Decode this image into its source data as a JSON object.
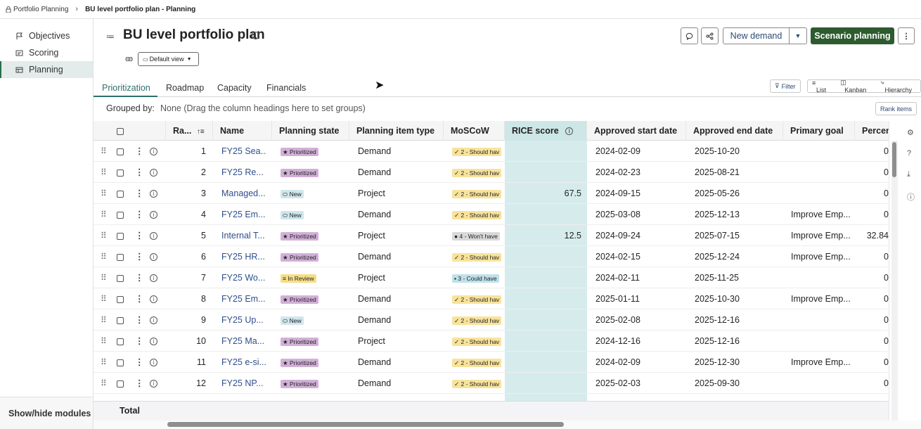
{
  "breadcrumb": {
    "root": "Portfolio Planning",
    "current": "BU level portfolio plan - Planning"
  },
  "sidebar": {
    "items": [
      {
        "label": "Objectives",
        "icon": "flag-icon",
        "active": false
      },
      {
        "label": "Scoring",
        "icon": "scoring-icon",
        "active": false
      },
      {
        "label": "Planning",
        "icon": "planning-icon",
        "active": true
      }
    ],
    "footer": "Show/hide modules"
  },
  "header": {
    "title": "BU level portfolio plan",
    "new_demand": "New demand",
    "scenario_planning": "Scenario planning"
  },
  "view": {
    "selected": "Default view"
  },
  "tabs": [
    "Prioritization",
    "Roadmap",
    "Capacity",
    "Financials"
  ],
  "toolbar": {
    "filter": "Filter",
    "list": "List",
    "kanban": "Kanban",
    "hierarchy": "Hierarchy",
    "rank_items": "Rank items"
  },
  "grouping": {
    "label": "Grouped by:",
    "hint": "None (Drag the column headings here to set groups)"
  },
  "columns": [
    "Ra...",
    "Name",
    "Planning state",
    "Planning item type",
    "MoSCoW",
    "RICE score",
    "Approved start date",
    "Approved end date",
    "Primary goal",
    "Percen"
  ],
  "rows": [
    {
      "rank": "1",
      "name": "FY25 Sea...",
      "state": "Prioritized",
      "type": "Demand",
      "moscow": "2 - Should hav",
      "rice": "",
      "start": "2024-02-09",
      "end": "2025-10-20",
      "goal": "",
      "pct": "0"
    },
    {
      "rank": "2",
      "name": "FY25 Re...",
      "state": "Prioritized",
      "type": "Demand",
      "moscow": "2 - Should hav",
      "rice": "",
      "start": "2024-02-23",
      "end": "2025-08-21",
      "goal": "",
      "pct": "0"
    },
    {
      "rank": "3",
      "name": "Managed...",
      "state": "New",
      "type": "Project",
      "moscow": "2 - Should hav",
      "rice": "67.5",
      "start": "2024-09-15",
      "end": "2025-05-26",
      "goal": "",
      "pct": "0"
    },
    {
      "rank": "4",
      "name": "FY25 Em...",
      "state": "New",
      "type": "Demand",
      "moscow": "2 - Should hav",
      "rice": "",
      "start": "2025-03-08",
      "end": "2025-12-13",
      "goal": "Improve Emp...",
      "pct": "0"
    },
    {
      "rank": "5",
      "name": "Internal T...",
      "state": "Prioritized",
      "type": "Project",
      "moscow": "4 - Won't have",
      "rice": "12.5",
      "start": "2024-09-24",
      "end": "2025-07-15",
      "goal": "Improve Emp...",
      "pct": "32.84"
    },
    {
      "rank": "6",
      "name": "FY25 HR...",
      "state": "Prioritized",
      "type": "Demand",
      "moscow": "2 - Should hav",
      "rice": "",
      "start": "2024-02-15",
      "end": "2025-12-24",
      "goal": "Improve Emp...",
      "pct": "0"
    },
    {
      "rank": "7",
      "name": "FY25 Wo...",
      "state": "In Review",
      "type": "Project",
      "moscow": "3 - Could have",
      "rice": "",
      "start": "2024-02-11",
      "end": "2025-11-25",
      "goal": "",
      "pct": "0"
    },
    {
      "rank": "8",
      "name": "FY25 Em...",
      "state": "Prioritized",
      "type": "Demand",
      "moscow": "2 - Should hav",
      "rice": "",
      "start": "2025-01-11",
      "end": "2025-10-30",
      "goal": "Improve Emp...",
      "pct": "0"
    },
    {
      "rank": "9",
      "name": "FY25 Up...",
      "state": "New",
      "type": "Demand",
      "moscow": "2 - Should hav",
      "rice": "",
      "start": "2025-02-08",
      "end": "2025-12-16",
      "goal": "",
      "pct": "0"
    },
    {
      "rank": "10",
      "name": "FY25 Ma...",
      "state": "Prioritized",
      "type": "Project",
      "moscow": "2 - Should hav",
      "rice": "",
      "start": "2024-12-16",
      "end": "2025-12-16",
      "goal": "",
      "pct": "0"
    },
    {
      "rank": "11",
      "name": "FY25 e-si...",
      "state": "Prioritized",
      "type": "Demand",
      "moscow": "2 - Should hav",
      "rice": "",
      "start": "2024-02-09",
      "end": "2025-12-30",
      "goal": "Improve Emp...",
      "pct": "0"
    },
    {
      "rank": "12",
      "name": "FY25 NP...",
      "state": "Prioritized",
      "type": "Demand",
      "moscow": "2 - Should hav",
      "rice": "",
      "start": "2025-02-03",
      "end": "2025-09-30",
      "goal": "",
      "pct": "0"
    }
  ],
  "total_label": "Total",
  "colors": {
    "accent": "#2e6f6a",
    "primary_button": "#2d5b2f",
    "rice_column": "#d6ecec",
    "link": "#2f4e8c"
  }
}
